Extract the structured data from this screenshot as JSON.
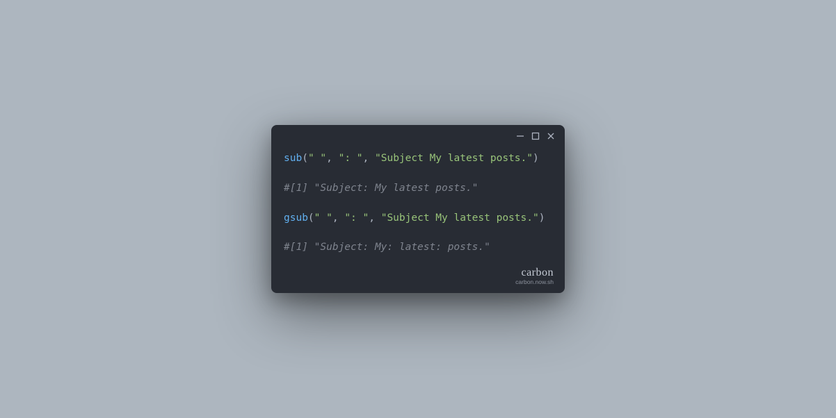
{
  "window": {
    "controls": {
      "minimize": "minimize",
      "maximize": "maximize",
      "close": "close"
    }
  },
  "code": {
    "lines": [
      {
        "type": "call",
        "func": "sub",
        "open": "(",
        "args": [
          {
            "text": "\" \""
          },
          {
            "text": "\": \""
          },
          {
            "text": "\"Subject My latest posts.\""
          }
        ],
        "sep": ", ",
        "close": ")"
      },
      {
        "type": "comment",
        "text": "#[1] \"Subject: My latest posts.\""
      },
      {
        "type": "blank"
      },
      {
        "type": "call",
        "func": "gsub",
        "open": "(",
        "args": [
          {
            "text": "\" \""
          },
          {
            "text": "\": \""
          },
          {
            "text": "\"Subject My latest posts.\""
          }
        ],
        "sep": ", ",
        "close": ")"
      },
      {
        "type": "comment",
        "text": "#[1] \"Subject: My: latest: posts.\""
      }
    ]
  },
  "branding": {
    "name": "carbon",
    "url": "carbon.now.sh"
  },
  "chart_data": {
    "type": "table",
    "title": "R sub vs gsub example",
    "series": [
      {
        "name": "sub(\" \", \": \", \"Subject My latest posts.\")",
        "values": [
          "Subject: My latest posts."
        ]
      },
      {
        "name": "gsub(\" \", \": \", \"Subject My latest posts.\")",
        "values": [
          "Subject: My: latest: posts."
        ]
      }
    ]
  }
}
